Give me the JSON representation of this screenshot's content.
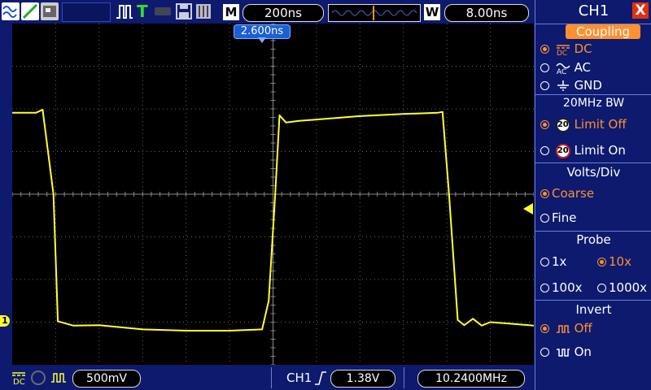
{
  "toolbar": {
    "m_label": "M",
    "timebase": "200ns",
    "w_label": "W",
    "window_time": "8.00ns",
    "trigger_marker": "T"
  },
  "screen": {
    "trigger_time": "2.600ns",
    "ch1_marker": "1"
  },
  "status": {
    "volts_div": "500mV",
    "trigger_source": "CH1",
    "trigger_level": "1.38V",
    "frequency": "10.2400MHz"
  },
  "panel": {
    "title": "CH1",
    "close": "X",
    "coupling": {
      "heading": "Coupling",
      "options": [
        {
          "label": "DC",
          "selected": true
        },
        {
          "label": "AC",
          "selected": false
        },
        {
          "label": "GND",
          "selected": false
        }
      ]
    },
    "bw": {
      "heading": "20MHz BW",
      "badge": "20",
      "options": [
        {
          "label": "Limit Off",
          "selected": true
        },
        {
          "label": "Limit On",
          "selected": false
        }
      ]
    },
    "volts": {
      "heading": "Volts/Div",
      "options": [
        {
          "label": "Coarse",
          "selected": true
        },
        {
          "label": "Fine",
          "selected": false
        }
      ]
    },
    "probe": {
      "heading": "Probe",
      "options": [
        {
          "label": "1x",
          "selected": false
        },
        {
          "label": "10x",
          "selected": true
        },
        {
          "label": "100x",
          "selected": false
        },
        {
          "label": "1000x",
          "selected": false
        }
      ]
    },
    "invert": {
      "heading": "Invert",
      "options": [
        {
          "label": "Off",
          "selected": true
        },
        {
          "label": "On",
          "selected": false
        }
      ]
    }
  },
  "colors": {
    "background": "#0d1a6e",
    "trace": "#ffff33",
    "accent": "#ff9030",
    "grid": "#666666"
  },
  "chart_data": {
    "type": "line",
    "xlabel": "",
    "ylabel": "",
    "x_div": [
      0.0,
      0.55,
      0.7,
      0.95,
      1.05,
      1.4,
      2.0,
      3.0,
      4.0,
      5.0,
      5.75,
      5.9,
      6.05,
      6.15,
      6.3,
      6.6,
      7.0,
      8.0,
      9.0,
      9.8,
      9.9,
      10.05,
      10.25,
      10.4,
      10.6,
      10.8,
      11.0,
      11.4,
      12.0
    ],
    "y_div": [
      1.91,
      1.91,
      1.98,
      0.0,
      -2.98,
      -3.08,
      -3.07,
      -3.17,
      -3.2,
      -3.2,
      -3.17,
      -2.5,
      0.0,
      1.85,
      1.68,
      1.72,
      1.75,
      1.83,
      1.88,
      1.91,
      1.93,
      0.0,
      -2.95,
      -3.07,
      -2.92,
      -3.08,
      -3.0,
      -3.03,
      -3.08
    ]
  }
}
